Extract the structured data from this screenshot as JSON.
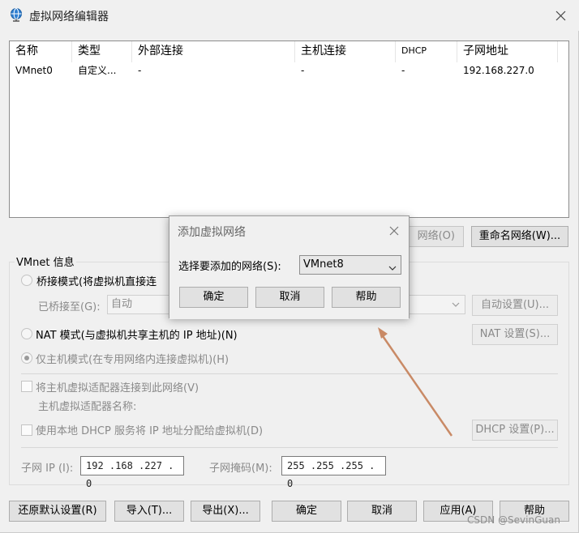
{
  "window": {
    "title": "虚拟网络编辑器"
  },
  "table": {
    "columns": [
      "名称",
      "类型",
      "外部连接",
      "主机连接",
      "DHCP",
      "子网地址"
    ],
    "rows": [
      [
        "VMnet0",
        "自定义...",
        "-",
        "-",
        "-",
        "192.168.227.0"
      ]
    ]
  },
  "buttons_mid": {
    "remove": "网络(O)",
    "rename": "重命名网络(W)..."
  },
  "vmnet": {
    "group_label": "VMnet 信息",
    "bridge_label": "桥接模式(将虚拟机直接连",
    "bridged_to_label": "已桥接至(G):",
    "bridged_to_value": "自动",
    "auto_settings": "自动设置(U)...",
    "nat_label": "NAT 模式(与虚拟机共享主机的 IP 地址)(N)",
    "nat_settings": "NAT 设置(S)...",
    "hostonly_label": "仅主机模式(在专用网络内连接虚拟机)(H)",
    "connect_adapter_label": "将主机虚拟适配器连接到此网络(V)",
    "adapter_name_label": "主机虚拟适配器名称:",
    "dhcp_label": "使用本地 DHCP 服务将 IP 地址分配给虚拟机(D)",
    "dhcp_settings": "DHCP 设置(P)...",
    "subnet_ip_label": "子网 IP (I):",
    "subnet_ip_value": "192 .168 .227 . 0",
    "subnet_mask_label": "子网掩码(M):",
    "subnet_mask_value": "255 .255 .255 . 0"
  },
  "footer": {
    "restore": "还原默认设置(R)",
    "import": "导入(T)...",
    "export": "导出(X)...",
    "ok": "确定",
    "cancel": "取消",
    "apply": "应用(A)",
    "help": "帮助"
  },
  "dialog": {
    "title": "添加虚拟网络",
    "select_label": "选择要添加的网络(S):",
    "select_value": "VMnet8",
    "ok": "确定",
    "cancel": "取消",
    "help": "帮助"
  },
  "watermark": "CSDN @SevinGuan",
  "colors": {
    "arrow": "#c98a66",
    "icon_blue": "#2f7fd1"
  }
}
